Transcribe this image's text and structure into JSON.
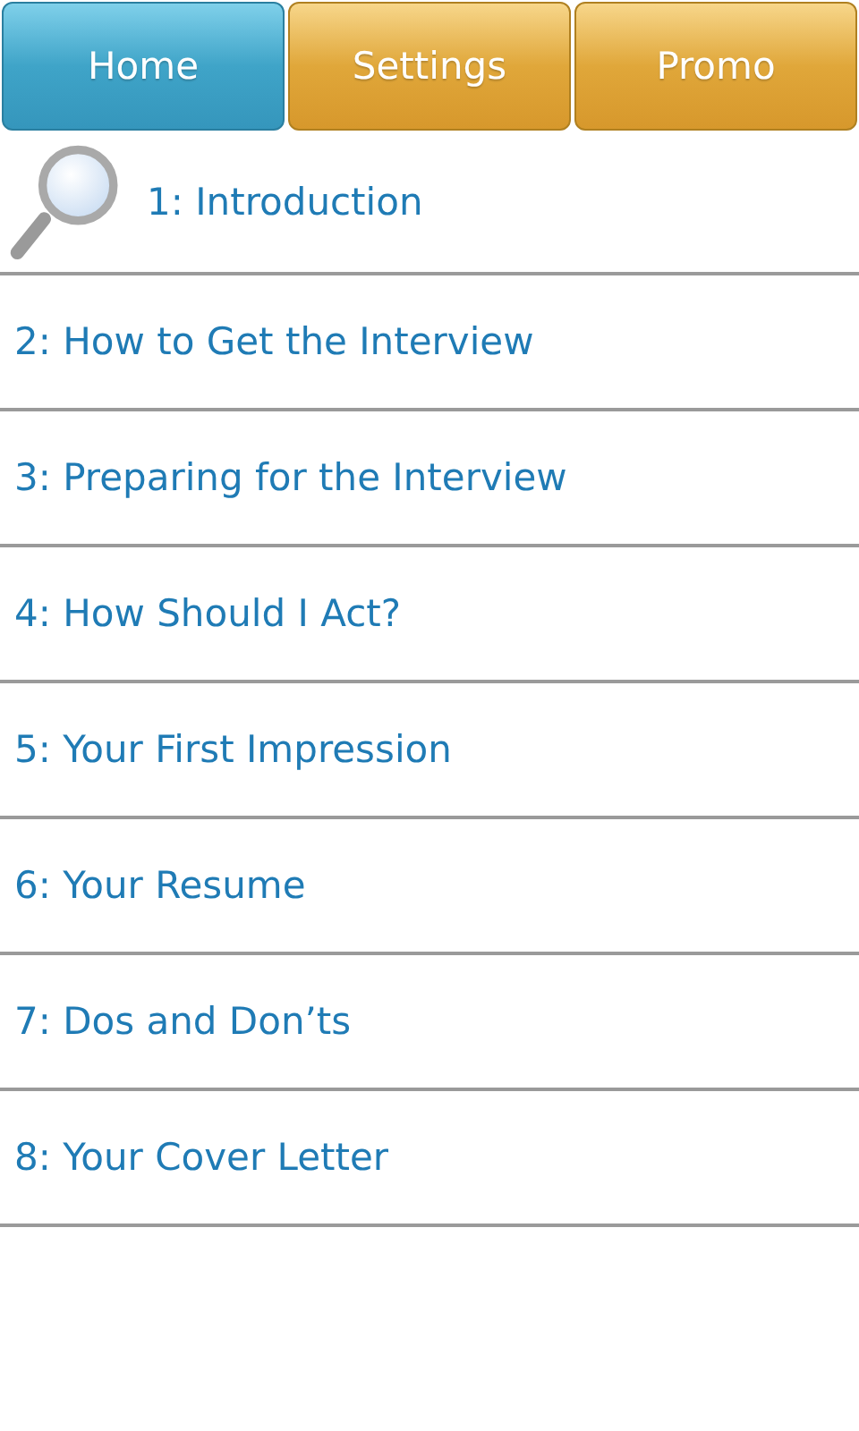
{
  "tabs": [
    {
      "label": "Home",
      "selected": true
    },
    {
      "label": "Settings",
      "selected": false
    },
    {
      "label": "Promo",
      "selected": false
    }
  ],
  "chapters": [
    {
      "title": "1: Introduction",
      "kind": "search"
    },
    {
      "title": "2: How to Get the Interview",
      "kind": "plain"
    },
    {
      "title": "3: Preparing for the Interview",
      "kind": "plain"
    },
    {
      "title": "4: How Should I Act?",
      "kind": "plain"
    },
    {
      "title": "5: Your First Impression",
      "kind": "plain"
    },
    {
      "title": "6: Your Resume",
      "kind": "plain"
    },
    {
      "title": "7: Dos and Don’ts",
      "kind": "plain"
    },
    {
      "title": "8: Your Cover Letter",
      "kind": "plain"
    }
  ]
}
